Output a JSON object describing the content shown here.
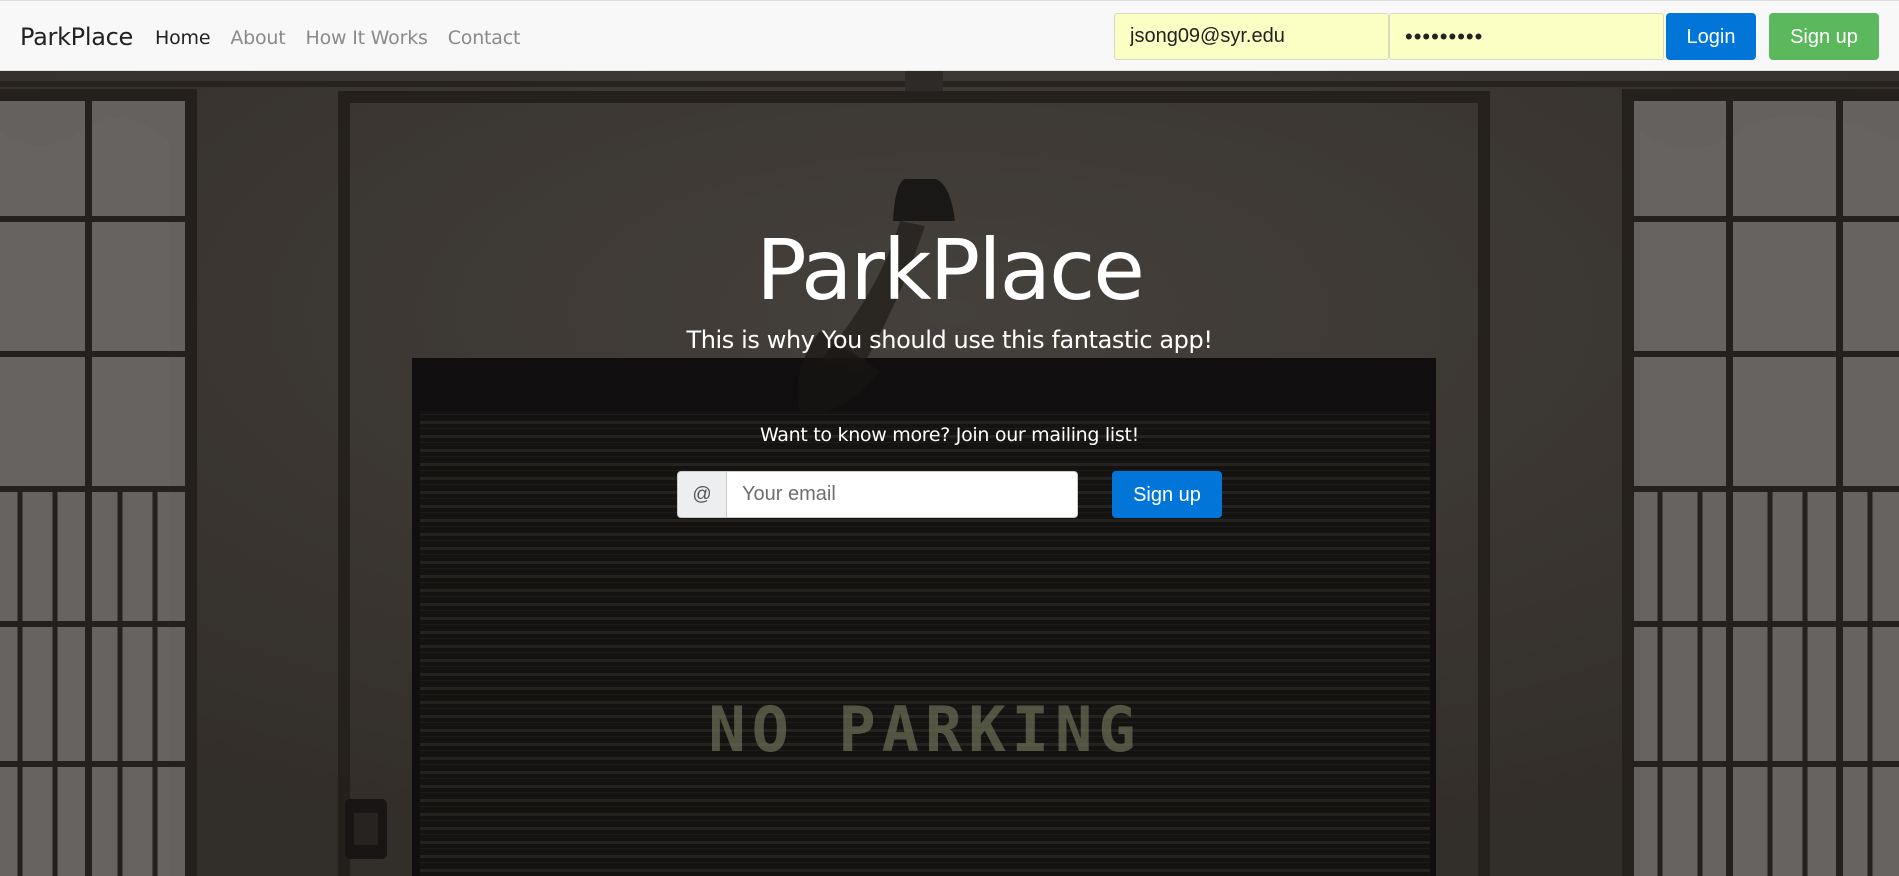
{
  "navbar": {
    "brand": "ParkPlace",
    "links": [
      {
        "label": "Home",
        "active": true
      },
      {
        "label": "About",
        "active": false
      },
      {
        "label": "How It Works",
        "active": false
      },
      {
        "label": "Contact",
        "active": false
      }
    ],
    "login": {
      "email_value": "jsong09@syr.edu",
      "password_value": "jsong0909",
      "login_label": "Login",
      "signup_label": "Sign up"
    }
  },
  "hero": {
    "title": "ParkPlace",
    "subtitle": "This is why You should use this fantastic app!",
    "mailing_prompt": "Want to know more? Join our mailing list!",
    "email_addon": "@",
    "email_placeholder": "Your email",
    "signup_label": "Sign up",
    "background_sign_text": "NO PARKING"
  },
  "colors": {
    "primary": "#0275d8",
    "success": "#5cb85c",
    "autofill": "#fcffc4",
    "navbar_bg": "#f8f8f8"
  }
}
